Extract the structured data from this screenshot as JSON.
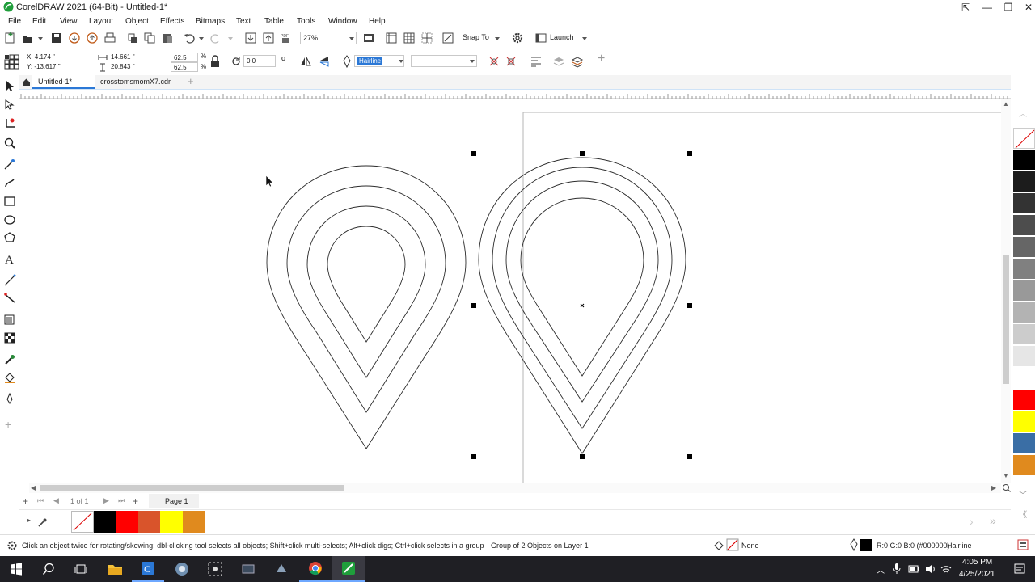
{
  "window": {
    "title": "CorelDRAW 2021 (64-Bit) - Untitled-1*"
  },
  "menu": [
    "File",
    "Edit",
    "View",
    "Layout",
    "Object",
    "Effects",
    "Bitmaps",
    "Text",
    "Table",
    "Tools",
    "Window",
    "Help"
  ],
  "toolbar": {
    "zoom_value": "27%",
    "snap_to_label": "Snap To",
    "launch_label": "Launch"
  },
  "property_bar": {
    "x_value": "X: 4.174 \"",
    "y_value": "Y: -13.617 \"",
    "width_value": "14.661 \"",
    "height_value": "20.843 \"",
    "scale_x": "62.5",
    "scale_y": "62.5",
    "percent_symbol": "%",
    "rotation_value": "0.0",
    "rotation_unit": "o",
    "outline_width": "Hairline"
  },
  "tabs": {
    "doc1": "Untitled-1*",
    "doc2": "crosstomsmomX7.cdr"
  },
  "page_nav": {
    "count": "1 of 1",
    "page_tab": "Page 1"
  },
  "status": {
    "hint": "Click an object twice for rotating/skewing; dbl-clicking tool selects all objects; Shift+click multi-selects; Alt+click digs; Ctrl+click selects in a group",
    "selection": "Group of 2 Objects on Layer 1",
    "fill_label": "None",
    "outline_color": "R:0 G:0 B:0 (#000000)",
    "outline_width": "Hairline"
  },
  "taskbar": {
    "time": "4:05 PM",
    "date": "4/25/2021"
  },
  "colors": {
    "palette": [
      "#ffffff",
      "#000000",
      "#1c1c1c",
      "#333333",
      "#4d4d4d",
      "#666666",
      "#808080",
      "#999999",
      "#b3b3b3",
      "#cccccc",
      "#e6e6e6",
      "#ffffff",
      "#ff0000",
      "#ffff00",
      "#3a6ea5",
      "#e08a1e"
    ],
    "doc_palette": [
      "none",
      "#000000",
      "#ff0000",
      "#d9542b",
      "#ffff00",
      "#e08a1e"
    ],
    "accent": "#2b78d6",
    "app_icon": "#1f9e3b"
  }
}
